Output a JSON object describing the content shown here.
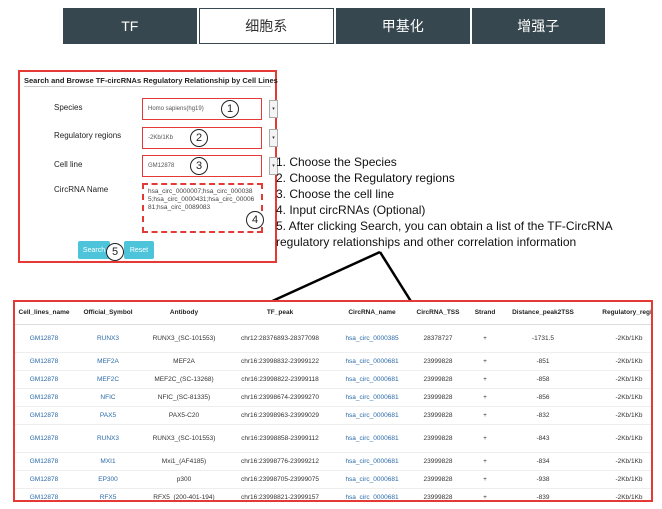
{
  "tabs": [
    "TF",
    "细胞系",
    "甲基化",
    "增强子"
  ],
  "panel": {
    "title": "Search and Browse TF-circRNAs Regulatory Relationship by Cell Lines",
    "species_label": "Species",
    "species_value": "Homo sapiens(hg19)",
    "regions_label": "Regulatory regions",
    "regions_value": "-2Kb/1Kb",
    "cellline_label": "Cell line",
    "cellline_value": "GM12878",
    "circrna_label": "CircRNA Name",
    "circrna_value": "hsa_circ_0000007;hsa_circ_0000385;hsa_circ_0000431;hsa_circ_0000681;hsa_circ_0089083",
    "search_label": "Search",
    "reset_label": "Reset",
    "markers": [
      "1",
      "2",
      "3",
      "4",
      "5"
    ]
  },
  "instructions": [
    "1. Choose the Species",
    "2. Choose the Regulatory regions",
    "3. Choose the cell line",
    "4. Input circRNAs (Optional)",
    "5. After clicking Search, you can obtain a list of the TF-CircRNA",
    "regulatory relationships and other correlation information"
  ],
  "table": {
    "headers": [
      "Cell_lines_name",
      "Official_Symbol",
      "Antibody",
      "TF_peak",
      "CircRNA_name",
      "CircRNA_TSS",
      "Strand",
      "Distance_peak2TSS",
      "Regulatory_regio"
    ],
    "rows": [
      [
        "GM12878",
        "RUNX3",
        "RUNX3_(SC-101553)",
        "chr12:28376893-28377098",
        "hsa_circ_0000385",
        "28378727",
        "+",
        "-1731.5",
        "-2Kb/1Kb"
      ],
      [
        "GM12878",
        "MEF2A",
        "MEF2A",
        "chr16:23998832-23999122",
        "hsa_circ_0000681",
        "23999828",
        "+",
        "-851",
        "-2Kb/1Kb"
      ],
      [
        "GM12878",
        "MEF2C",
        "MEF2C_(SC-13268)",
        "chr16:23998822-23999118",
        "hsa_circ_0000681",
        "23999828",
        "+",
        "-858",
        "-2Kb/1Kb"
      ],
      [
        "GM12878",
        "NFIC",
        "NFIC_(SC-81335)",
        "chr16:23998674-23999270",
        "hsa_circ_0000681",
        "23999828",
        "+",
        "-856",
        "-2Kb/1Kb"
      ],
      [
        "GM12878",
        "PAX5",
        "PAX5-C20",
        "chr16:23998963-23999029",
        "hsa_circ_0000681",
        "23999828",
        "+",
        "-832",
        "-2Kb/1Kb"
      ],
      [
        "GM12878",
        "RUNX3",
        "RUNX3_(SC-101553)",
        "chr16:23998858-23999112",
        "hsa_circ_0000681",
        "23999828",
        "+",
        "-843",
        "-2Kb/1Kb"
      ],
      [
        "GM12878",
        "MXI1",
        "Mxi1_(AF4185)",
        "chr16:23998776-23999212",
        "hsa_circ_0000681",
        "23999828",
        "+",
        "-834",
        "-2Kb/1Kb"
      ],
      [
        "GM12878",
        "EP300",
        "p300",
        "chr16:23998705-23999075",
        "hsa_circ_0000681",
        "23999828",
        "+",
        "-938",
        "-2Kb/1Kb"
      ],
      [
        "GM12878",
        "RFX5",
        "RFX5_(200-401-194)",
        "chr16:23998821-23999157",
        "hsa_circ_0000681",
        "23999828",
        "+",
        "-839",
        "-2Kb/1Kb"
      ]
    ]
  }
}
